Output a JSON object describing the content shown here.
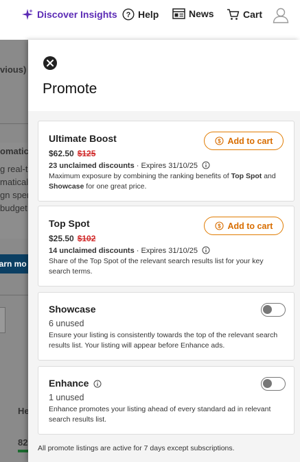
{
  "nav": {
    "discover_label": "Discover Insights",
    "help_label": "Help",
    "news_label": "News",
    "cart_label": "Cart"
  },
  "background": {
    "prev_text": "vious)",
    "auto_text": "omatic",
    "line1": "g real-t",
    "line2": "matical",
    "line3": "gn spen",
    "line4": " budget",
    "button_text": "earn mo",
    "col_head": "He",
    "num": "82"
  },
  "panel": {
    "title": "Promote",
    "cards": [
      {
        "name": "Ultimate Boost",
        "price_now": "$62.50",
        "price_old": "$125",
        "discount_count": "23 unclaimed discounts",
        "expires": " · Expires 31/10/25",
        "desc_1": "Maximum exposure by combining the ranking benefits of ",
        "desc_b1": "Top Spot",
        "desc_2": " and ",
        "desc_b2": "Showcase",
        "desc_3": " for one great price.",
        "button": "Add to cart"
      },
      {
        "name": "Top Spot",
        "price_now": "$25.50",
        "price_old": "$102",
        "discount_count": "14 unclaimed discounts",
        "expires": " · Expires 31/10/25",
        "desc": "Share of the Top Spot of the relevant search results list for your key search terms.",
        "button": "Add to cart"
      },
      {
        "name": "Showcase",
        "unused": "6 unused",
        "desc": "Ensure your listing is consistently towards the top of the relevant search results list. Your listing will appear before Enhance ads.",
        "toggle_on": false
      },
      {
        "name": "Enhance",
        "unused": "1 unused",
        "desc": "Enhance promotes your listing ahead of every standard ad in relevant search results list.",
        "toggle_on": false
      }
    ],
    "footer": "All promote listings are active for 7 days except subscriptions."
  },
  "colors": {
    "accent_orange": "#e07b00",
    "strike_red": "#d12b2b",
    "discover_purple": "#5b2bb5"
  }
}
